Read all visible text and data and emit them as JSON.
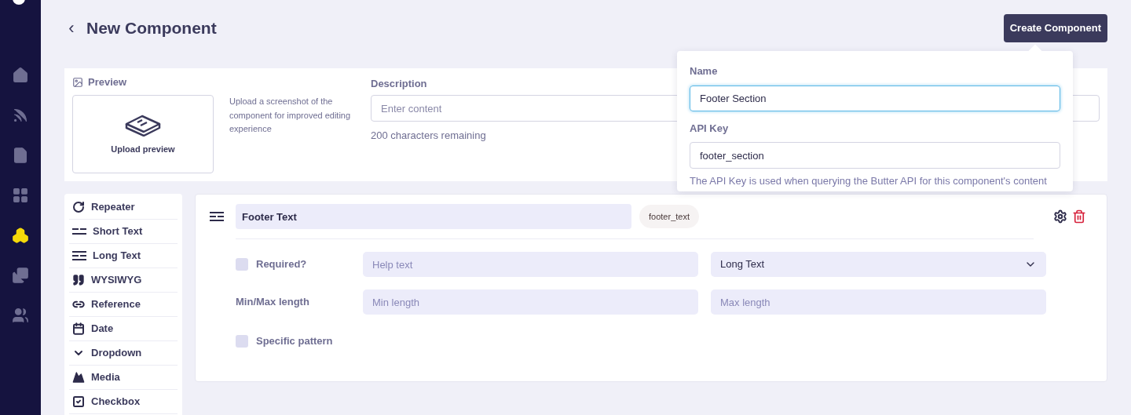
{
  "nav": [
    {
      "kind": "home",
      "selected": false
    },
    {
      "kind": "blog",
      "selected": false
    },
    {
      "kind": "page",
      "selected": false
    },
    {
      "kind": "table",
      "selected": false
    },
    {
      "kind": "components",
      "selected": true
    },
    {
      "kind": "media",
      "selected": false
    },
    {
      "kind": "users",
      "selected": false
    }
  ],
  "header": {
    "back": "‹",
    "title": "New Component",
    "create_button": "Create Component"
  },
  "preview": {
    "label": "Preview",
    "upload": "Upload preview",
    "hint": "Upload a screenshot of the component for improved editing experience"
  },
  "description": {
    "label": "Description",
    "placeholder": "Enter content",
    "remaining": "200 characters remaining"
  },
  "popover": {
    "name_label": "Name",
    "name_value": "Footer Section",
    "name_focused": true,
    "key_label": "API Key",
    "key_value": "footer_section",
    "key_hint": "The API Key is used when querying the Butter API for this component's content"
  },
  "field_types": [
    {
      "kind": "repeater",
      "label": "Repeater"
    },
    {
      "kind": "short",
      "label": "Short Text"
    },
    {
      "kind": "long",
      "label": "Long Text"
    },
    {
      "kind": "wysiwyg",
      "label": "WYSIWYG"
    },
    {
      "kind": "reference",
      "label": "Reference"
    },
    {
      "kind": "date",
      "label": "Date"
    },
    {
      "kind": "dropdown",
      "label": "Dropdown"
    },
    {
      "kind": "media",
      "label": "Media"
    },
    {
      "kind": "checkbox",
      "label": "Checkbox"
    }
  ],
  "field": {
    "name": "Footer Text",
    "key": "footer_text",
    "required_label": "Required?",
    "required": false,
    "help_placeholder": "Help text",
    "type": "Long Text",
    "minmax_label": "Min/Max length",
    "min_placeholder": "Min length",
    "max_placeholder": "Max length",
    "pattern_label": "Specific pattern",
    "pattern": false
  }
}
